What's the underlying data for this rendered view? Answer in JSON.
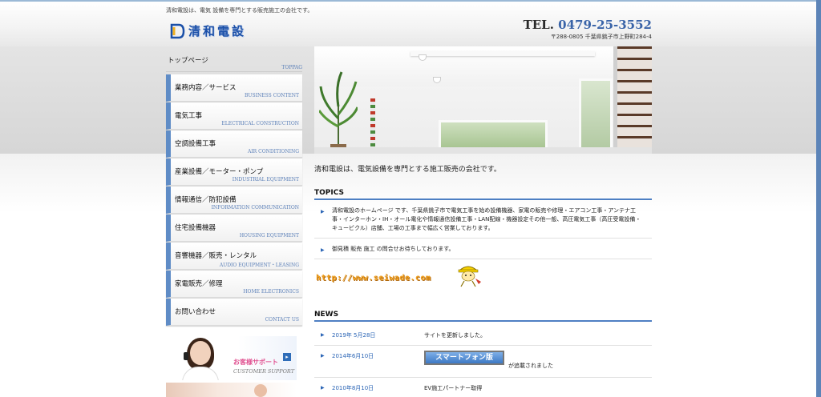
{
  "header": {
    "tagline": "清和電設は、電気 設備を専門とする販売施工の会社です。",
    "logo_text": "清和電設",
    "tel_label": "TEL.",
    "tel_number": "0479-25-3552",
    "address": "〒288-0805 千葉県銚子市上野町284-4"
  },
  "sidebar": {
    "top": {
      "jp": "トップページ",
      "en": "TOPPAG"
    },
    "items": [
      {
        "jp": "業務内容／サービス",
        "en": "BUSINESS CONTENT"
      },
      {
        "jp": "電気工事",
        "en": "ELECTRICAL CONSTRUCTION"
      },
      {
        "jp": "空調設備工事",
        "en": "AIR CONDITIONING"
      },
      {
        "jp": "産業設備／モーター・ポンプ",
        "en": "INDUSTRIAL EQUIPMENT"
      },
      {
        "jp": "情報通信／防犯設備",
        "en": "INFORMATION COMMUNICATION"
      },
      {
        "jp": "住宅設備機器",
        "en": "HOUSING EQUIPMENT"
      },
      {
        "jp": "音響機器／販売・レンタル",
        "en": "AUDIO EQUIPMENT・LEASING"
      },
      {
        "jp": "家電販売／修理",
        "en": "HOME ELECTRONICS"
      },
      {
        "jp": "お問い合わせ",
        "en": "CONTACT US"
      }
    ],
    "support": {
      "jp": "お客様サポート",
      "en": "CUSTOMER SUPPORT",
      "arrow": "▸"
    }
  },
  "main": {
    "intro": "清和電設は、電気設備を専門とする施工販売の会社です。",
    "topics_heading": "TOPICS",
    "topics": [
      {
        "text": "清和電設のホームページ です、千葉県銚子市で電気工事を始め設備機器、家電の販売や修理・エアコン工事・アンテナ工事・インターホン・IH・オール電化や情報通信設備工事・LAN配線・機器設定その他一般、高圧電気工事（高圧受電設備・キュービクル）店舗、工場の工事まで幅広く営業しております。"
      },
      {
        "text": "御見積 販売 施工 の問合せお待ちしております。"
      }
    ],
    "promo_url": "http://www.seiwade.com",
    "news_heading": "NEWS",
    "news": [
      {
        "date": "2019年 5月28日",
        "text": "サイトを更新しました。"
      },
      {
        "date": "2014年6月10日",
        "badge": "スマートフォン版",
        "text": "が追載されました"
      },
      {
        "date": "2010年8月10日",
        "text": "EV施工パートナー取得"
      }
    ],
    "arrow_glyph": "▶"
  },
  "colors": {
    "accent": "#4e7fc3",
    "logo": "#1a4fa8",
    "date": "#2a64b5",
    "promo": "#f0a020"
  }
}
